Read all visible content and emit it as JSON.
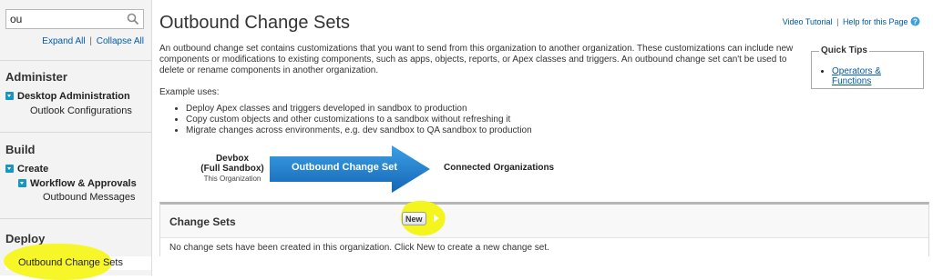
{
  "sidebar": {
    "search": {
      "value": "ou",
      "placeholder": ""
    },
    "expand_all": "Expand All",
    "collapse_all": "Collapse All",
    "separator": "|",
    "sections": [
      {
        "title": "Administer"
      },
      {
        "title": "Build"
      },
      {
        "title": "Deploy"
      }
    ],
    "items": {
      "desktop_admin": "Desktop Administration",
      "outlook_config": "Outlook Configurations",
      "create": "Create",
      "workflow": "Workflow & Approvals",
      "outbound_messages": "Outbound Messages",
      "outbound_change_sets": "Outbound Change Sets"
    }
  },
  "main": {
    "title": "Outbound Change Sets",
    "help": {
      "video": "Video Tutorial",
      "separator": "|",
      "help_page": "Help for this Page",
      "help_icon": "help-question-icon"
    },
    "description": "An outbound change set contains customizations that you want to send from this organization to another organization. These customizations can include new components or modifications to existing components, such as apps, objects, reports, or Apex classes and triggers. An outbound change set can't be used to delete or rename components in another organization.",
    "example_label": "Example uses:",
    "examples": [
      "Deploy Apex classes and triggers developed in sandbox to production",
      "Copy custom objects and other customizations to a sandbox without refreshing it",
      "Migrate changes across environments, e.g. dev sandbox to QA sandbox to production"
    ],
    "quick_tips": {
      "title": "Quick Tips",
      "link": "Operators & Functions"
    },
    "diagram": {
      "source_line1": "Devbox",
      "source_line2": "(Full Sandbox)",
      "source_sub": "This Organization",
      "arrow_label": "Outbound Change Set",
      "target": "Connected Organizations"
    },
    "change_sets": {
      "title": "Change Sets",
      "new_button": "New",
      "empty_message": "No change sets have been created in this organization. Click New to create a new change set."
    }
  },
  "colors": {
    "accent": "#015ba7",
    "arrow": "#1f7fc7",
    "highlight": "#f5f51e",
    "toggle": "#1797c0"
  }
}
